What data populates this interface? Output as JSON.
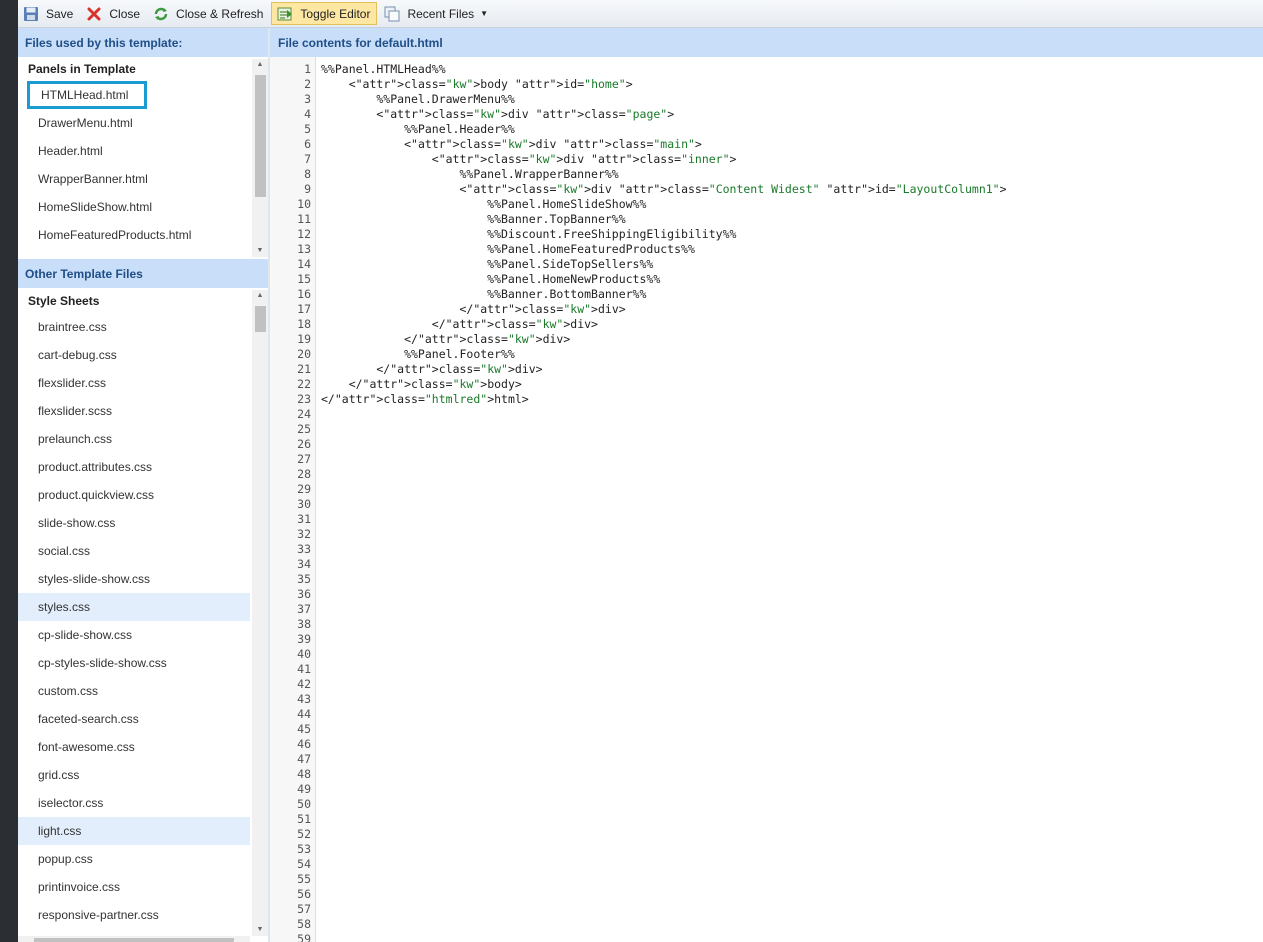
{
  "toolbar": {
    "save": "Save",
    "close": "Close",
    "close_refresh": "Close & Refresh",
    "toggle_editor": "Toggle Editor",
    "recent_files": "Recent Files"
  },
  "left_header": "Files used by this template:",
  "right_header": "File contents for default.html",
  "panels": {
    "title": "Panels in Template",
    "items": [
      "HTMLHead.html",
      "DrawerMenu.html",
      "Header.html",
      "WrapperBanner.html",
      "HomeSlideShow.html",
      "HomeFeaturedProducts.html"
    ]
  },
  "other_files": {
    "header": "Other Template Files",
    "title": "Style Sheets",
    "items": [
      "braintree.css",
      "cart-debug.css",
      "flexslider.css",
      "flexslider.scss",
      "prelaunch.css",
      "product.attributes.css",
      "product.quickview.css",
      "slide-show.css",
      "social.css",
      "styles-slide-show.css",
      "styles.css",
      "cp-slide-show.css",
      "cp-styles-slide-show.css",
      "custom.css",
      "faceted-search.css",
      "font-awesome.css",
      "grid.css",
      "iselector.css",
      "light.css",
      "popup.css",
      "printinvoice.css",
      "responsive-partner.css"
    ]
  },
  "editor": {
    "line_numbers": [
      "1",
      "2",
      "3",
      "4",
      "5",
      "6",
      "7",
      "8",
      "9",
      "10",
      "11",
      "12",
      "13",
      "14",
      "15",
      "16",
      "17",
      "18",
      "19",
      "20",
      "21",
      "22",
      "23",
      "24",
      "25",
      "26",
      "27",
      "28",
      "29",
      "30",
      "31",
      "32",
      "33",
      "34",
      "35",
      "36",
      "37",
      "38",
      "39",
      "40",
      "41",
      "42",
      "43",
      "44",
      "45",
      "46",
      "47",
      "48",
      "49",
      "50",
      "51",
      "52",
      "53",
      "54",
      "55",
      "56",
      "57",
      "58",
      "59"
    ],
    "code_lines": [
      "%%Panel.HTMLHead%%",
      "    <body id=\"home\">",
      "        %%Panel.DrawerMenu%%",
      "        <div class=\"page\">",
      "            %%Panel.Header%%",
      "            <div class=\"main\">",
      "                <div class=\"inner\">",
      "                    %%Panel.WrapperBanner%%",
      "                    <div class=\"Content Widest\" id=\"LayoutColumn1\">",
      "                        %%Panel.HomeSlideShow%%",
      "                        %%Banner.TopBanner%%",
      "                        %%Discount.FreeShippingEligibility%%",
      "                        %%Panel.HomeFeaturedProducts%%",
      "                        %%Panel.SideTopSellers%%",
      "                        %%Panel.HomeNewProducts%%",
      "                        %%Banner.BottomBanner%%",
      "                    </div>",
      "                </div>",
      "            </div>",
      "            %%Panel.Footer%%",
      "        </div>",
      "    </body>",
      "</html>"
    ]
  }
}
